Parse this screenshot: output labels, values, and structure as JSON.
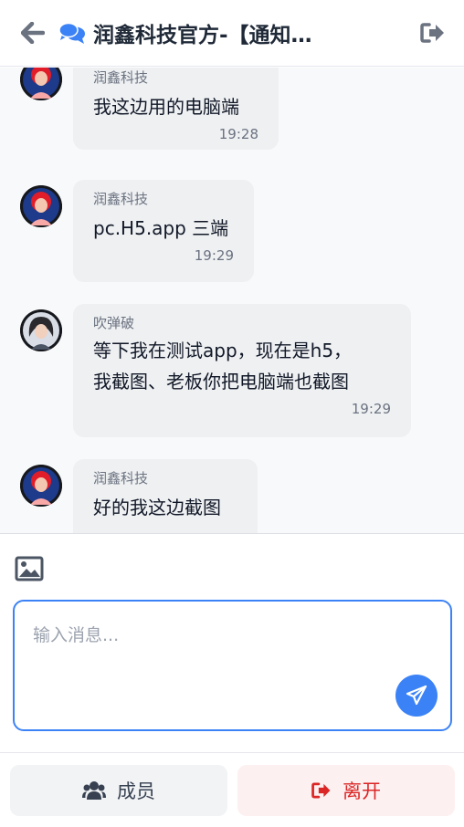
{
  "header": {
    "title": "润鑫科技官方-【通知…",
    "icons": {
      "back": "arrow-left-icon",
      "chat": "comments-icon",
      "exit": "sign-out-icon"
    }
  },
  "messages": [
    {
      "sender": "润鑫科技",
      "text": "我这边用的电脑端",
      "time": "19:28",
      "avatar": "red-hair-avatar"
    },
    {
      "sender": "润鑫科技",
      "text": "pc.H5.app 三端",
      "time": "19:29",
      "avatar": "red-hair-avatar"
    },
    {
      "sender": "吹弹破",
      "text_lines": [
        "等下我在测试app，现在是h5，",
        "我截图、老板你把电脑端也截图"
      ],
      "time": "19:29",
      "avatar": "dark-hair-avatar"
    },
    {
      "sender": "润鑫科技",
      "text": "好的我这边截图",
      "avatar": "red-hair-avatar"
    }
  ],
  "composer": {
    "placeholder": "输入消息...",
    "value": "",
    "icons": {
      "image": "image-icon",
      "send": "paper-plane-icon"
    }
  },
  "footer": {
    "members_label": "成员",
    "leave_label": "离开",
    "icons": {
      "members": "users-icon",
      "leave": "sign-out-icon"
    }
  },
  "colors": {
    "accent": "#3b82f6",
    "danger": "#dc2626",
    "bubble": "#eef0f2",
    "chat_bg": "#f8f9fa"
  }
}
